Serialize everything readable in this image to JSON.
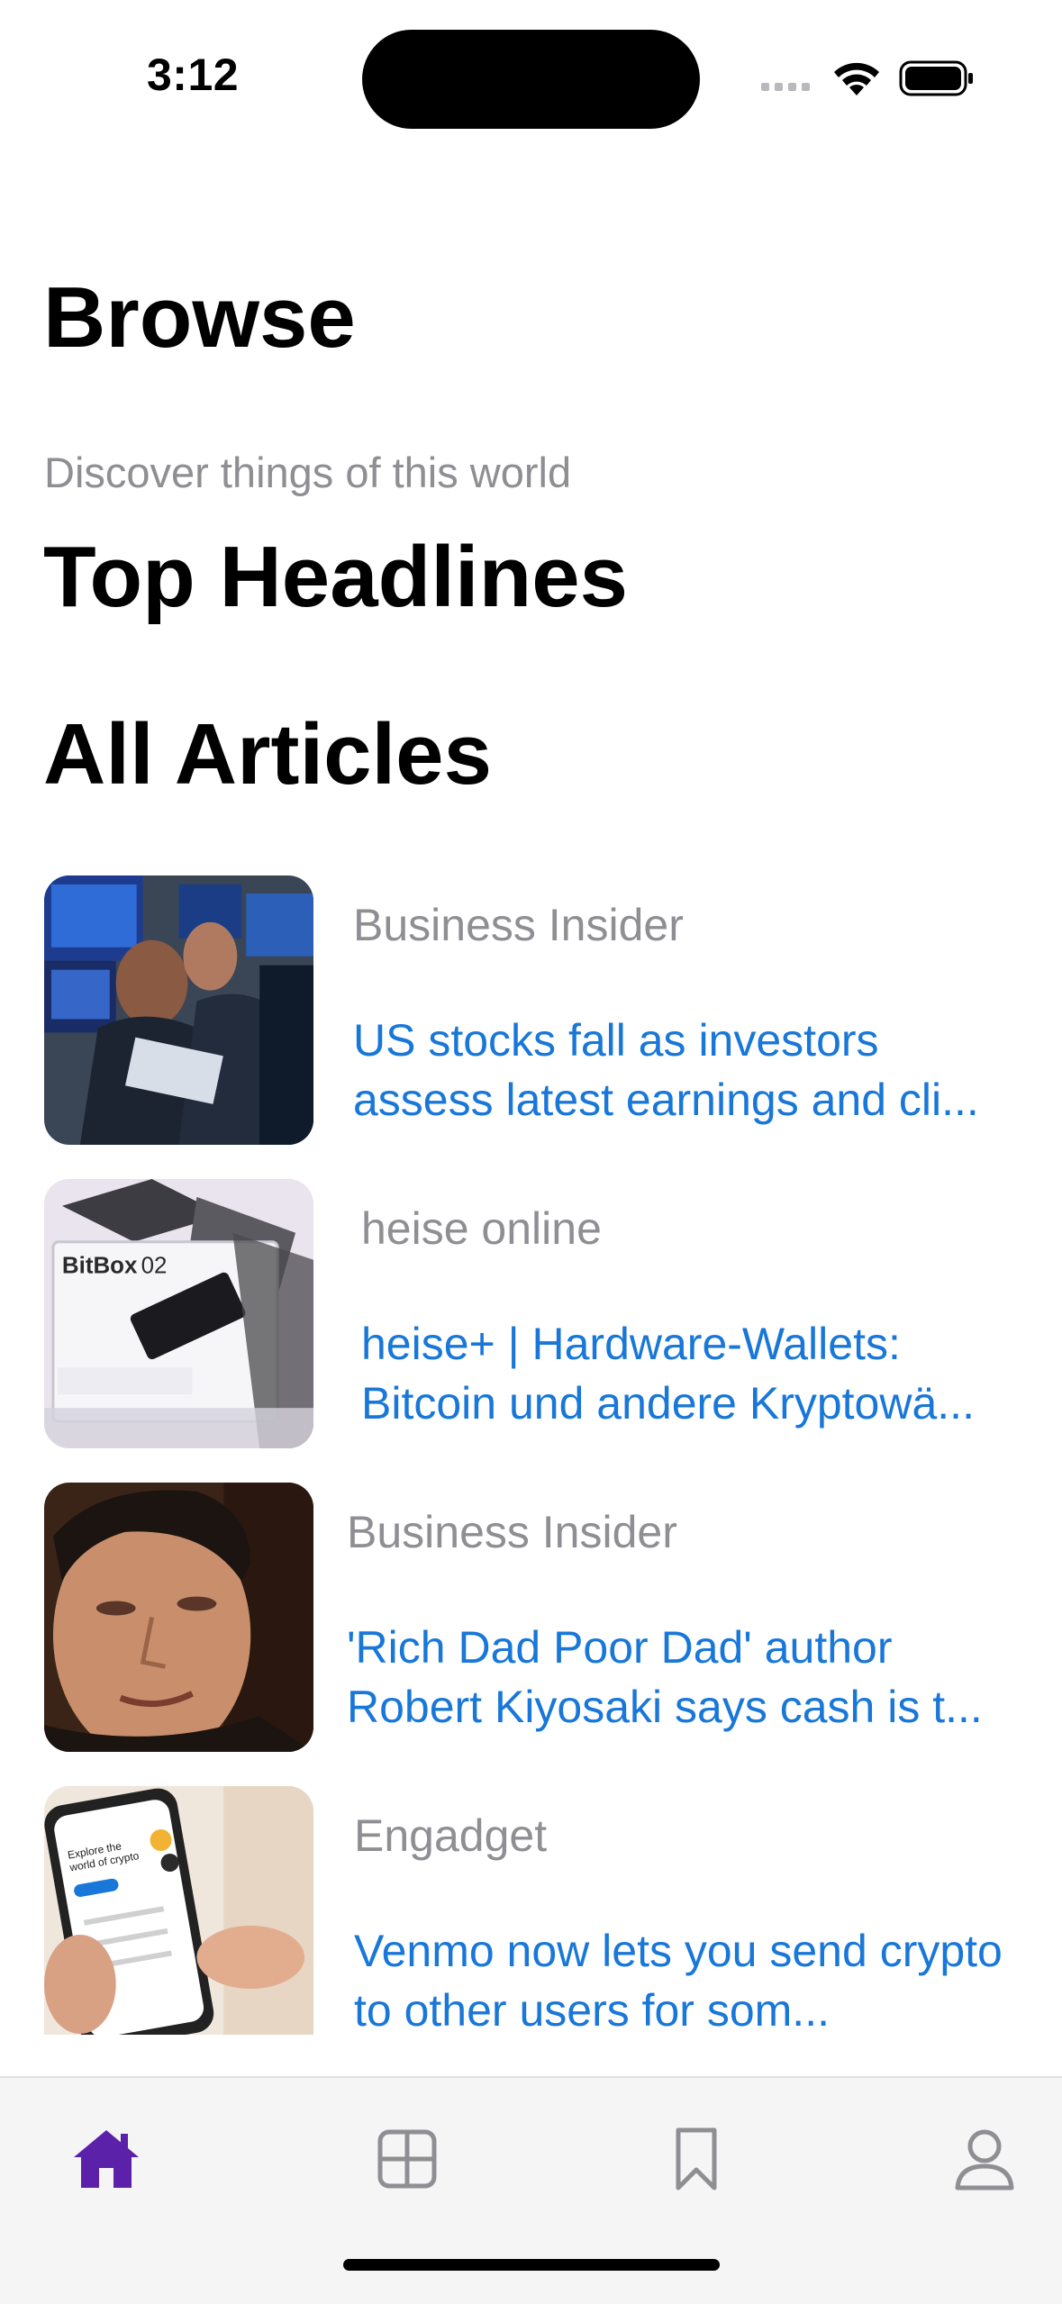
{
  "status_bar": {
    "time": "3:12"
  },
  "page": {
    "title": "Browse",
    "subtitle": "Discover things of this world",
    "top_headlines_title": "Top Headlines",
    "all_articles_title": "All Articles"
  },
  "articles": [
    {
      "source": "Business Insider",
      "title": "US stocks fall as investors assess latest earnings and cli...",
      "image": "trading-floor-photo"
    },
    {
      "source": "heise online",
      "title": "heise+ | Hardware-Wallets: Bitcoin und andere Kryptowä...",
      "image": "bitbox-hardware-wallet-photo"
    },
    {
      "source": "Business Insider",
      "title": "'Rich Dad Poor Dad' author Robert Kiyosaki says cash is t...",
      "image": "portrait-photo"
    },
    {
      "source": "Engadget",
      "title": "Venmo now lets you send crypto to other users for som...",
      "image": "phone-app-photo"
    }
  ],
  "tab_bar": {
    "items": [
      {
        "name": "home",
        "icon": "house-icon",
        "active": true
      },
      {
        "name": "categories",
        "icon": "grid-icon",
        "active": false
      },
      {
        "name": "bookmarks",
        "icon": "bookmark-icon",
        "active": false
      },
      {
        "name": "profile",
        "icon": "person-icon",
        "active": false
      }
    ],
    "active_color": "#5b21a8",
    "inactive_color": "#8e8e93"
  },
  "colors": {
    "headline_link": "#1877d8",
    "secondary_text": "#8e8e93"
  }
}
